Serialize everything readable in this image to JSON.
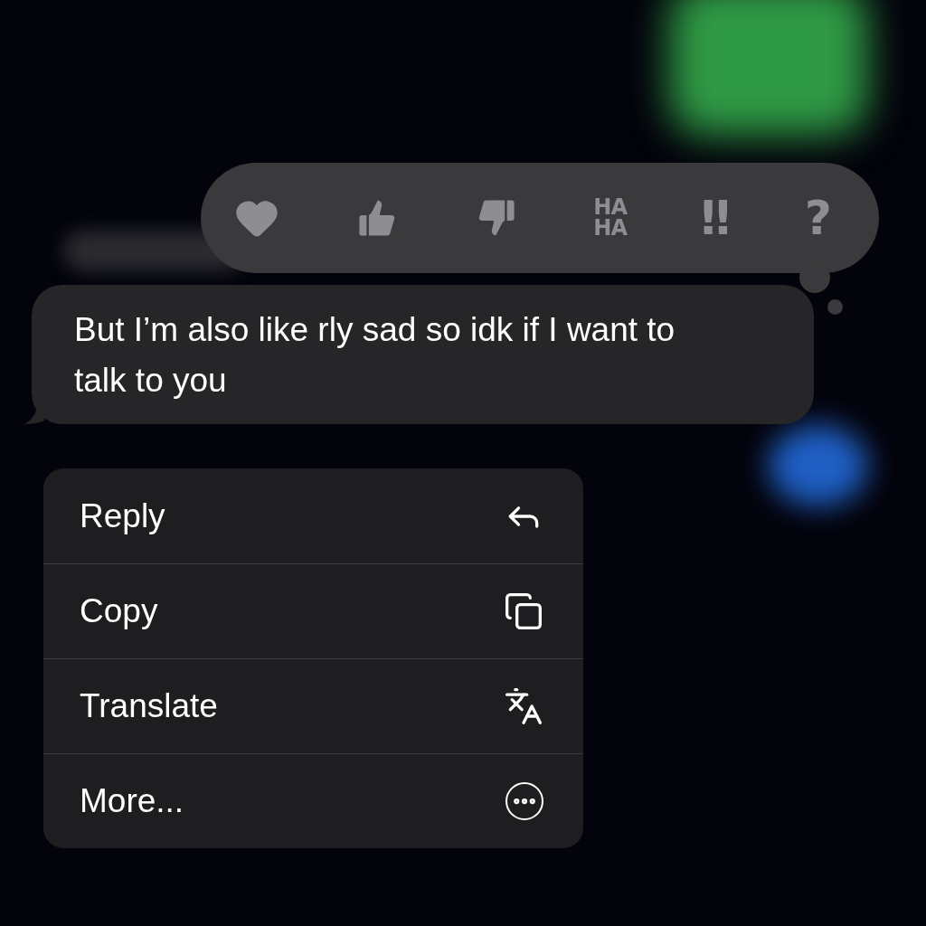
{
  "reactions": [
    {
      "kind": "heart"
    },
    {
      "kind": "thumbs-up"
    },
    {
      "kind": "thumbs-down"
    },
    {
      "kind": "stacked",
      "lines": [
        "HA",
        "HA"
      ]
    },
    {
      "kind": "glyph",
      "text": "‼"
    },
    {
      "kind": "glyph",
      "text": "?"
    }
  ],
  "message": {
    "text": "But I’m also like rly sad so idk if I want to talk to you"
  },
  "menu": [
    {
      "label": "Reply",
      "kind": "reply"
    },
    {
      "label": "Copy",
      "kind": "copy"
    },
    {
      "label": "Translate",
      "kind": "translate"
    },
    {
      "label": "More...",
      "kind": "more"
    }
  ]
}
